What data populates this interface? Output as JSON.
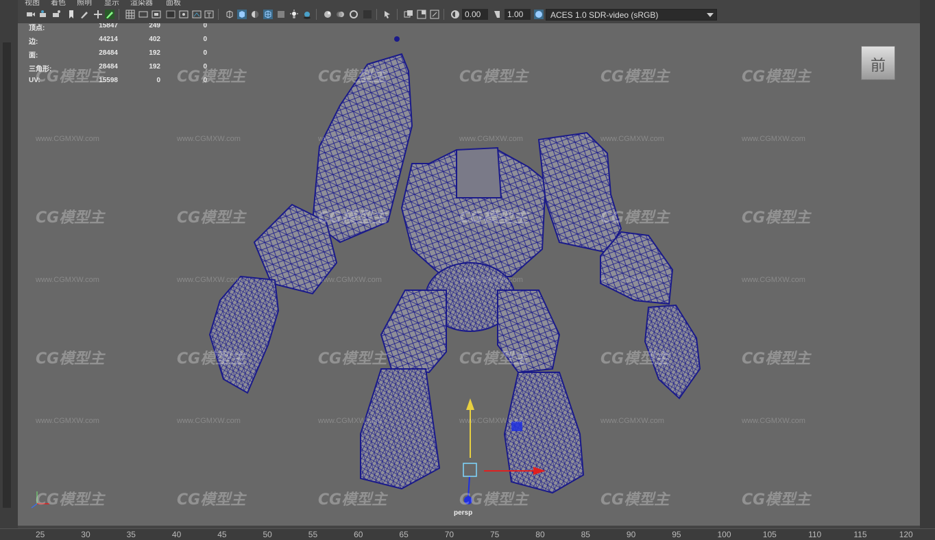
{
  "menu": [
    "视图",
    "着色",
    "照明",
    "显示",
    "渲染器",
    "面板"
  ],
  "toolbar": {
    "gamma_value": "0.00",
    "exposure_value": "1.00",
    "color_space": "ACES 1.0 SDR-video (sRGB)"
  },
  "hud": {
    "rows": [
      {
        "label": "顶点:",
        "v1": "15847",
        "v2": "249",
        "v3": "0"
      },
      {
        "label": "边:",
        "v1": "44214",
        "v2": "402",
        "v3": "0"
      },
      {
        "label": "面:",
        "v1": "28484",
        "v2": "192",
        "v3": "0"
      },
      {
        "label": "三角形:",
        "v1": "28484",
        "v2": "192",
        "v3": "0"
      },
      {
        "label": "UV:",
        "v1": "15598",
        "v2": "0",
        "v3": "0"
      }
    ]
  },
  "viewcube_label": "前",
  "camera_label": "persp",
  "watermark_logo": "CG模型主",
  "watermark_url": "www.CGMXW.com",
  "timeline_ticks": [
    "25",
    "30",
    "35",
    "40",
    "45",
    "50",
    "55",
    "60",
    "65",
    "70",
    "75",
    "80",
    "85",
    "90",
    "95",
    "100",
    "105",
    "110",
    "115",
    "120"
  ],
  "colors": {
    "viewport_bg": "#686868",
    "wireframe": "#1a1a8a",
    "mesh_fill": "#8e8e98",
    "axis_x": "#e02020",
    "axis_y": "#e8d040",
    "axis_z": "#2030e0",
    "accent": "#4aa0c8"
  }
}
